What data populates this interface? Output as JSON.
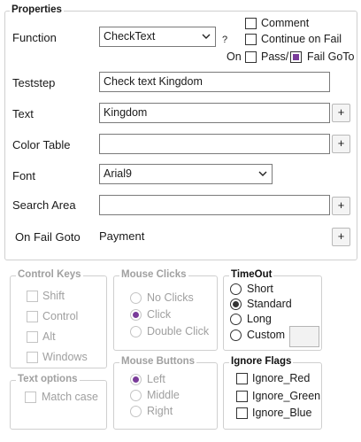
{
  "properties": {
    "legend": "Properties",
    "function_label": "Function",
    "function_value": "CheckText",
    "help_mark": "?",
    "comment_label": "Comment",
    "continue_on_fail_label": "Continue on Fail",
    "on_label": "On",
    "pass_label": "Pass/",
    "fail_goto_label": "Fail GoTo",
    "teststep_label": "Teststep",
    "teststep_value": "Check text Kingdom",
    "text_label": "Text",
    "text_value": "Kingdom",
    "color_table_label": "Color Table",
    "color_table_value": "",
    "font_label": "Font",
    "font_value": "Arial9",
    "search_area_label": "Search Area",
    "search_area_value": "",
    "on_fail_goto_label": "On Fail Goto",
    "on_fail_goto_value": "Payment",
    "plus": "+"
  },
  "control_keys": {
    "legend": "Control Keys",
    "items": [
      "Shift",
      "Control",
      "Alt",
      "Windows"
    ]
  },
  "mouse_clicks": {
    "legend": "Mouse Clicks",
    "items": [
      "No Clicks",
      "Click",
      "Double Click"
    ],
    "selected": "Click"
  },
  "timeout": {
    "legend": "TimeOut",
    "items": [
      "Short",
      "Standard",
      "Long",
      "Custom"
    ],
    "selected": "Standard"
  },
  "text_options": {
    "legend": "Text options",
    "match_case": "Match case"
  },
  "mouse_buttons": {
    "legend": "Mouse Buttons",
    "items": [
      "Left",
      "Middle",
      "Right"
    ],
    "selected": "Left"
  },
  "ignore_flags": {
    "legend": "Ignore Flags",
    "items": [
      "Ignore_Red",
      "Ignore_Green",
      "Ignore_Blue"
    ]
  },
  "colors": {
    "accent": "#7a3c9a",
    "border": "#7a7a7a",
    "disabled_text": "#a0a0a0"
  }
}
